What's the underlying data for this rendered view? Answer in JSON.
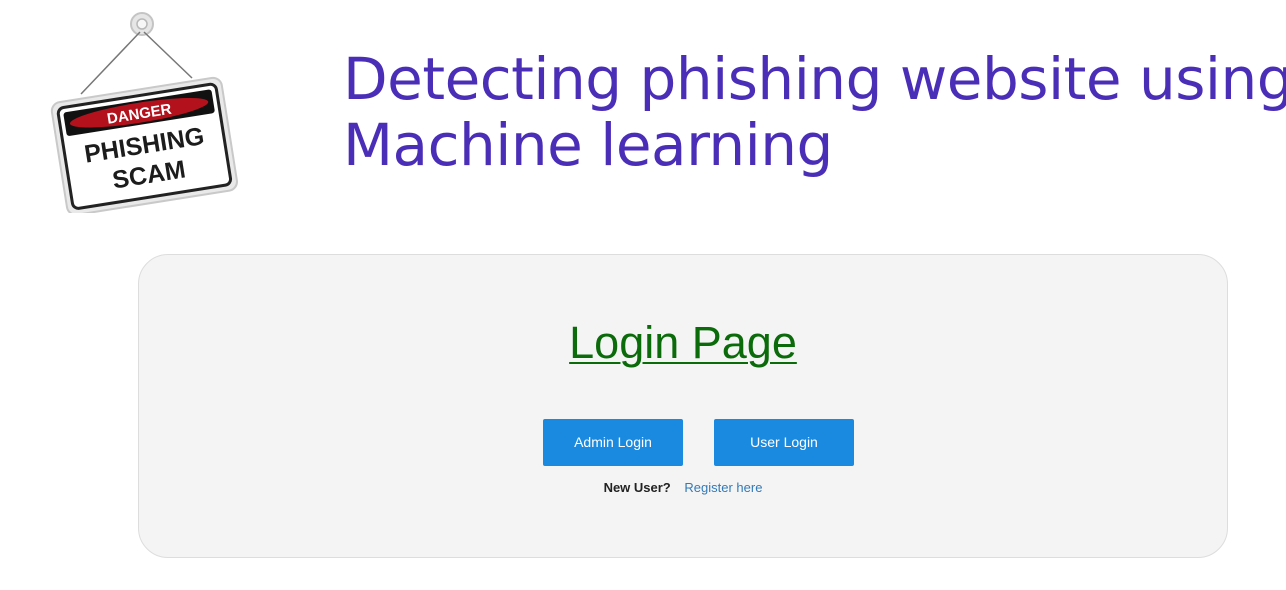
{
  "logo": {
    "icon": "danger-phishing-scam-sign",
    "banner_text": "DANGER",
    "line1": "PHISHING",
    "line2": "SCAM"
  },
  "header": {
    "title_line1": "Detecting phishing website using",
    "title_line2": "Machine learning"
  },
  "login": {
    "heading": "Login Page",
    "admin_button": "Admin Login",
    "user_button": "User Login",
    "new_user_label": "New User?",
    "register_link": "Register here"
  },
  "colors": {
    "title": "#4b2eb8",
    "heading": "#0b6b0b",
    "button": "#1a8ae0",
    "link": "#337ab7",
    "panel": "#f4f4f4",
    "danger_red": "#b3121c"
  }
}
